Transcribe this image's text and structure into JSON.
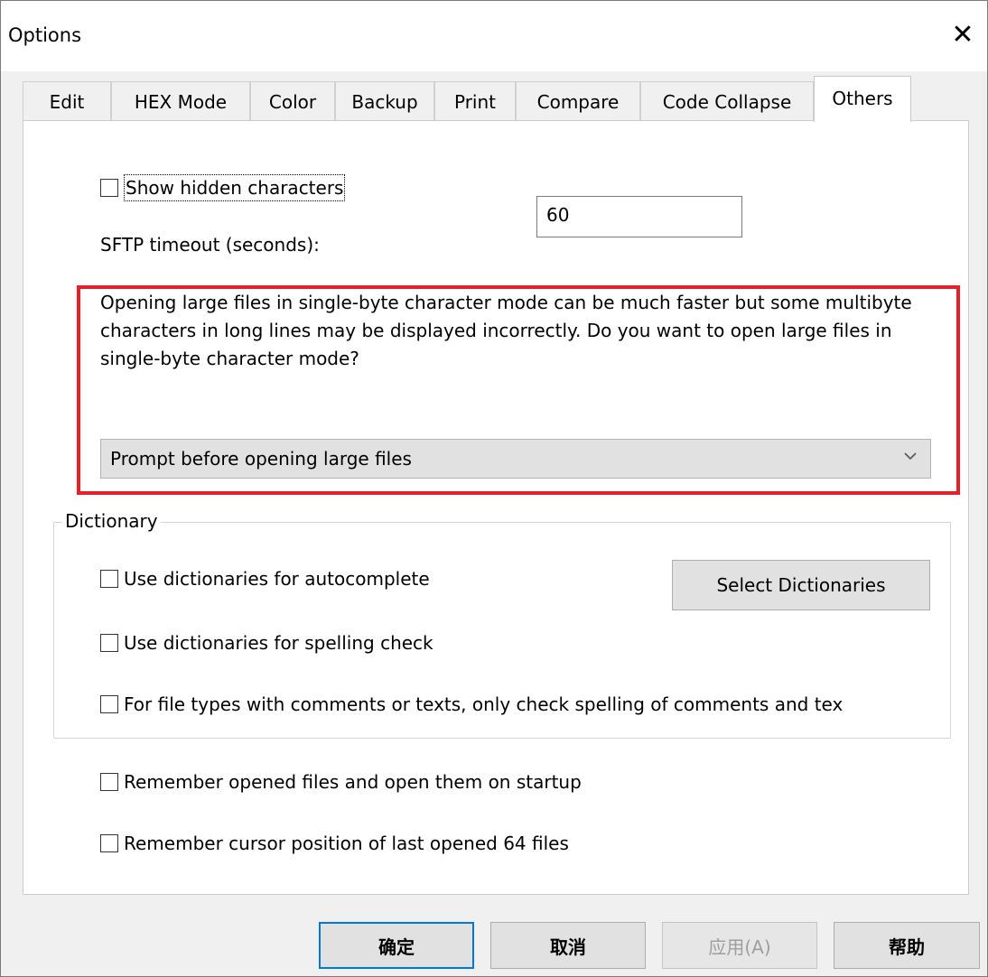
{
  "window": {
    "title": "Options",
    "close_symbol": "✕"
  },
  "tabs": [
    {
      "label": "Edit"
    },
    {
      "label": "HEX Mode"
    },
    {
      "label": "Color"
    },
    {
      "label": "Backup"
    },
    {
      "label": "Print"
    },
    {
      "label": "Compare"
    },
    {
      "label": "Code Collapse"
    },
    {
      "label": "Others",
      "active": true
    }
  ],
  "others": {
    "show_hidden_label": "Show hidden characters",
    "sftp_label": "SFTP timeout (seconds):",
    "sftp_value": "60",
    "large_file_text": "Opening large files in single-byte character mode can be much faster but some multibyte characters in long lines may be displayed incorrectly. Do you want to open large files in single-byte character mode?",
    "large_file_option": "Prompt before opening large files",
    "dictionary": {
      "legend": "Dictionary",
      "autocomplete_label": "Use dictionaries for autocomplete",
      "select_button": "Select Dictionaries",
      "spelling_label": "Use dictionaries for spelling check",
      "comments_label": "For file types with comments or texts, only check spelling of comments and tex"
    },
    "remember_files_label": "Remember opened files and open them on startup",
    "remember_cursor_label": "Remember cursor position of last opened 64 files"
  },
  "buttons": {
    "ok": "确定",
    "cancel": "取消",
    "apply": "应用(A)",
    "help": "帮助"
  },
  "colors": {
    "highlight": "#e5202a",
    "default_button": "#0078d7"
  }
}
